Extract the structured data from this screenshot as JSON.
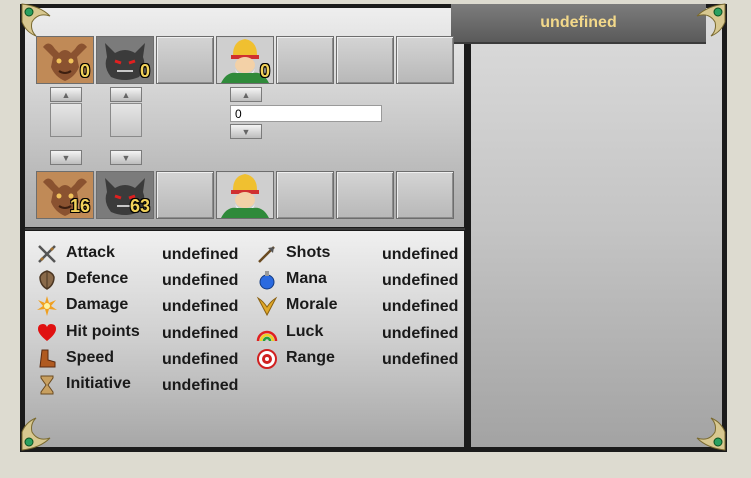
{
  "header": {
    "title": "undefined"
  },
  "army_top": [
    {
      "name": "Minotaur",
      "count": "0"
    },
    {
      "name": "Shadow Demon",
      "count": "0"
    },
    {
      "name": "",
      "count": ""
    },
    {
      "name": "Sultan",
      "count": "0"
    },
    {
      "name": "",
      "count": ""
    },
    {
      "name": "",
      "count": ""
    },
    {
      "name": "",
      "count": ""
    }
  ],
  "army_bottom": [
    {
      "name": "Minotaur",
      "count": "16"
    },
    {
      "name": "Shadow Demon",
      "count": "63"
    },
    {
      "name": "",
      "count": ""
    },
    {
      "name": "Sultan",
      "count": ""
    },
    {
      "name": "",
      "count": ""
    },
    {
      "name": "",
      "count": ""
    },
    {
      "name": "",
      "count": ""
    }
  ],
  "split_input": {
    "value": "0"
  },
  "stats_left": [
    {
      "label": "Attack",
      "value": "undefined",
      "icon": "sword-icon"
    },
    {
      "label": "Defence",
      "value": "undefined",
      "icon": "shield-icon"
    },
    {
      "label": "Damage",
      "value": "undefined",
      "icon": "burst-icon"
    },
    {
      "label": "Hit points",
      "value": "undefined",
      "icon": "heart-icon"
    },
    {
      "label": "Speed",
      "value": "undefined",
      "icon": "boot-icon"
    },
    {
      "label": "Initiative",
      "value": "undefined",
      "icon": "hourglass-icon"
    }
  ],
  "stats_right": [
    {
      "label": "Shots",
      "value": "undefined",
      "icon": "arrow-icon"
    },
    {
      "label": "Mana",
      "value": "undefined",
      "icon": "potion-icon"
    },
    {
      "label": "Morale",
      "value": "undefined",
      "icon": "wings-icon"
    },
    {
      "label": "Luck",
      "value": "undefined",
      "icon": "rainbow-icon"
    },
    {
      "label": "Range",
      "value": "undefined",
      "icon": "target-icon"
    }
  ],
  "colors": {
    "accent": "#f3d98a",
    "frame": "#1b1b1b",
    "count": "#f2d25a"
  }
}
